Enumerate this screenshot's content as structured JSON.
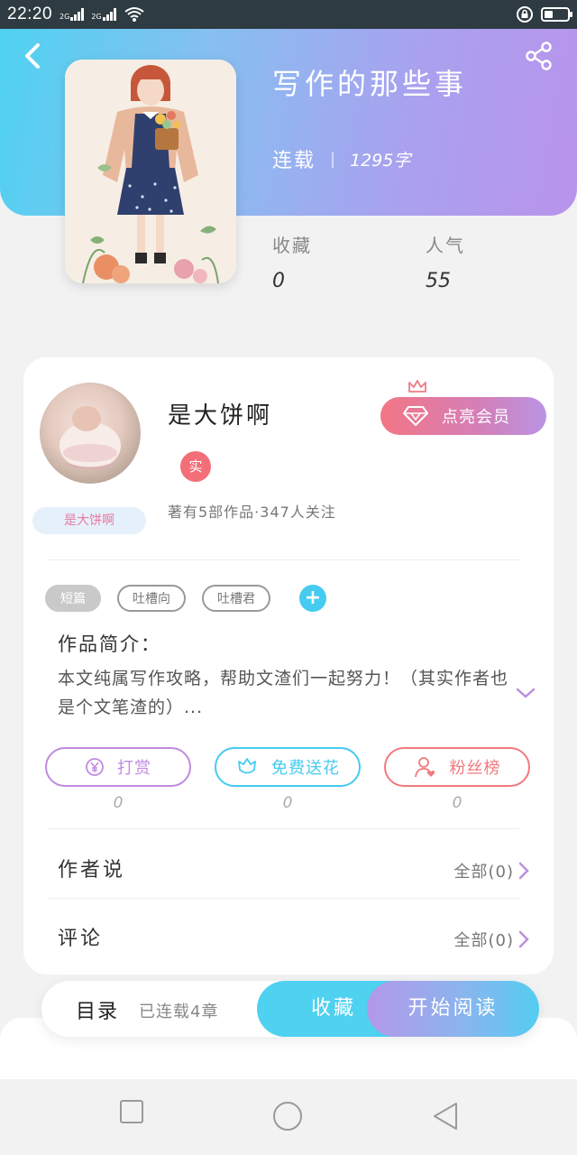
{
  "status_bar": {
    "time": "22:20",
    "signal1_label": "2G",
    "signal2_label": "2G"
  },
  "book": {
    "title": "写作的那些事",
    "status": "连载",
    "separator": "|",
    "word_count": "1295字",
    "stats": [
      {
        "label": "收藏",
        "value": "0"
      },
      {
        "label": "人气",
        "value": "55"
      }
    ]
  },
  "author": {
    "name": "是大饼啊",
    "avatar_tag": "是大饼啊",
    "real_badge": "实",
    "stats": "著有5部作品·347人关注",
    "vip_button": "点亮会员"
  },
  "tags": [
    "短篇",
    "吐槽向",
    "吐槽君"
  ],
  "intro": {
    "title": "作品简介：",
    "text": "本文纯属写作攻略，帮助文渣们一起努力！（其实作者也是个文笔渣的）..."
  },
  "actions": [
    {
      "label": "打赏",
      "count": "0",
      "color": "#c08ae0",
      "icon": "yen-icon"
    },
    {
      "label": "免费送花",
      "count": "0",
      "color": "#45cbf0",
      "icon": "flower-icon"
    },
    {
      "label": "粉丝榜",
      "count": "0",
      "color": "#f07a7e",
      "icon": "fans-icon"
    }
  ],
  "rows": [
    {
      "title": "作者说",
      "more": "全部(0)"
    },
    {
      "title": "评论",
      "more": "全部(0)"
    }
  ],
  "bottom_bar": {
    "toc_label": "目录",
    "toc_sub": "已连载4章",
    "favorite": "收藏",
    "start_reading": "开始阅读"
  },
  "colors": {
    "accent_cyan": "#4fd1f0",
    "accent_purple": "#b994ec",
    "accent_pink": "#f37685"
  }
}
